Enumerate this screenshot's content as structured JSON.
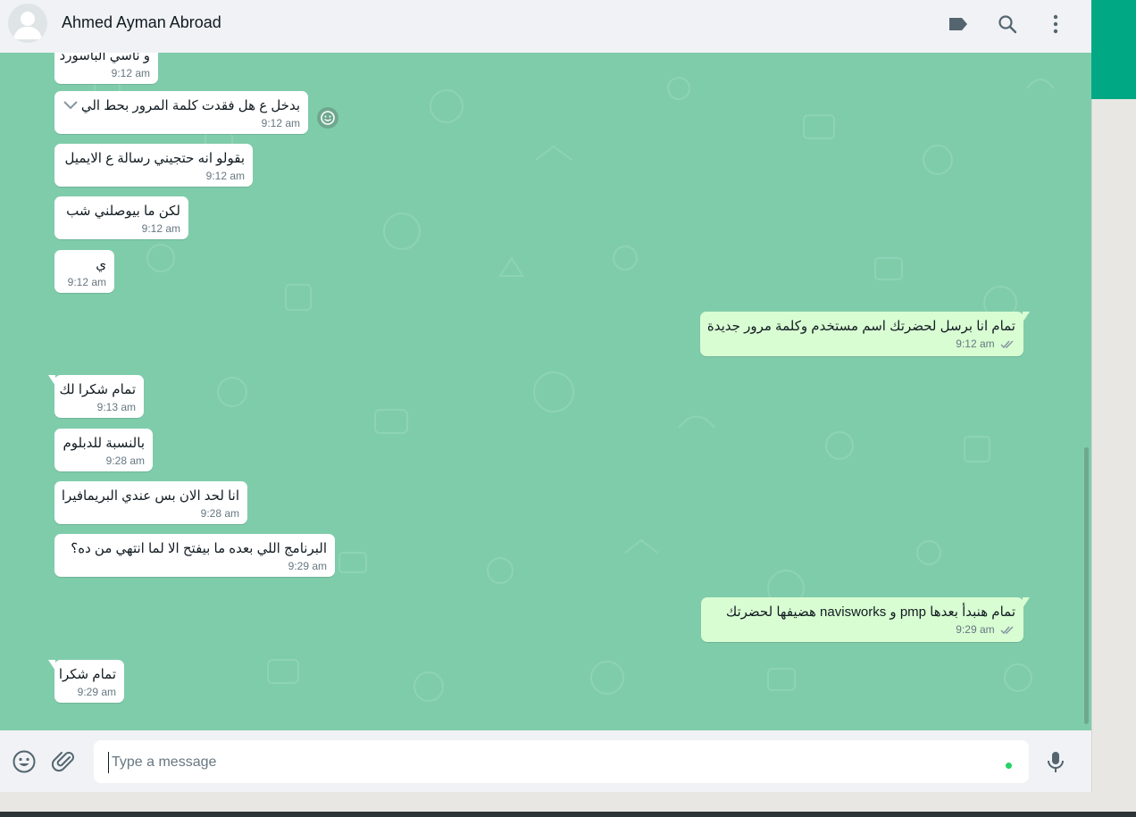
{
  "header": {
    "contact_name": "Ahmed Ayman Abroad",
    "icons": [
      "label-icon",
      "search-icon",
      "menu-icon"
    ]
  },
  "messages": [
    {
      "dir": "in",
      "text": "و ناسي الباسورد",
      "time": "9:12 am"
    },
    {
      "dir": "in",
      "text": "بدخل ع هل فقدت كلمة المرور بحط الي",
      "time": "9:12 am"
    },
    {
      "dir": "in",
      "text": "بقولو انه حتجيني رسالة ع الايميل",
      "time": "9:12 am"
    },
    {
      "dir": "in",
      "text": "لكن ما بيوصلني شب",
      "time": "9:12 am"
    },
    {
      "dir": "in",
      "text": "ي",
      "time": "9:12 am"
    },
    {
      "dir": "out",
      "text": "تمام انا برسل لحضرتك اسم مستخدم وكلمة مرور جديدة",
      "time": "9:12 am"
    },
    {
      "dir": "in",
      "text": "تمام شكرا لك",
      "time": "9:13 am"
    },
    {
      "dir": "in",
      "text": "بالنسبة للدبلوم",
      "time": "9:28 am"
    },
    {
      "dir": "in",
      "text": "انا لحد الان بس عندي البريمافيرا",
      "time": "9:28 am"
    },
    {
      "dir": "in",
      "text": "البرنامج اللي بعده ما بيفتح الا لما انتهي من ده؟",
      "time": "9:29 am"
    },
    {
      "dir": "out",
      "text": "تمام هنبدأ بعدها pmp و navisworks هضيفها لحضرتك",
      "time": "9:29 am"
    },
    {
      "dir": "in",
      "text": "تمام شكرا",
      "time": "9:29 am"
    }
  ],
  "composer": {
    "placeholder": "Type a message",
    "icons": [
      "emoji-icon",
      "attach-icon",
      "microphone-icon"
    ]
  },
  "colors": {
    "wallpaper": "#7fccab",
    "incoming_bubble": "#ffffff",
    "outgoing_bubble": "#d9fdd3",
    "accent": "#00a884"
  }
}
